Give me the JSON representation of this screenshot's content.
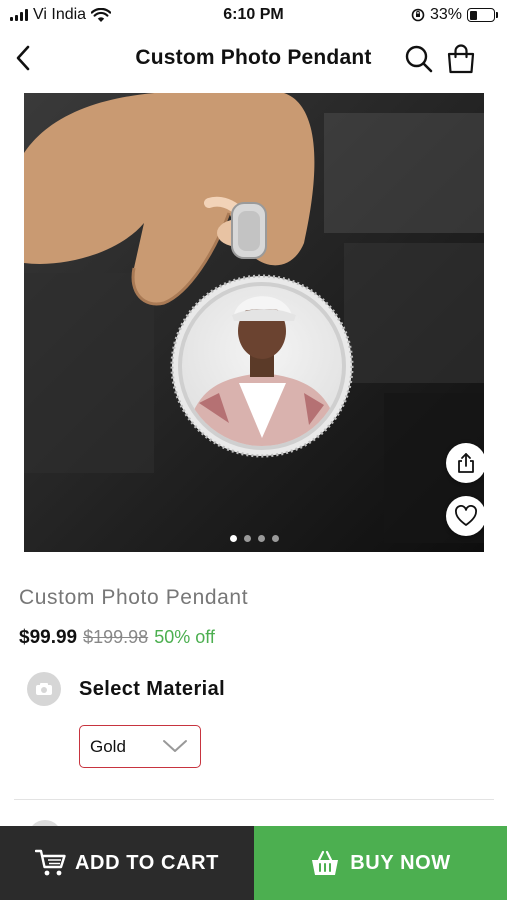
{
  "status_bar": {
    "carrier": "Vi India",
    "time": "6:10 PM",
    "battery": "33%",
    "battery_level": 0.33
  },
  "header": {
    "title": "Custom Photo Pendant",
    "icons": [
      "back-arrow-icon",
      "search-icon",
      "shopping-bag-icon"
    ]
  },
  "gallery": {
    "image_count": 4,
    "active_index": 0,
    "share_icon": "share-icon",
    "wishlist_icon": "heart-icon"
  },
  "product": {
    "name": "Custom Photo Pendant",
    "price": "$99.99",
    "original_price": "$199.98",
    "discount": "50% off"
  },
  "material": {
    "label": "Select Material",
    "selected": "Gold",
    "icon": "material-icon"
  },
  "actions": {
    "add_to_cart": "ADD TO CART",
    "buy_now": "BUY NOW"
  },
  "colors": {
    "add_to_cart_bg": "#2b2b2b",
    "buy_now_bg": "#4caf50",
    "discount": "#4caf50",
    "select_border": "#c7343f"
  }
}
